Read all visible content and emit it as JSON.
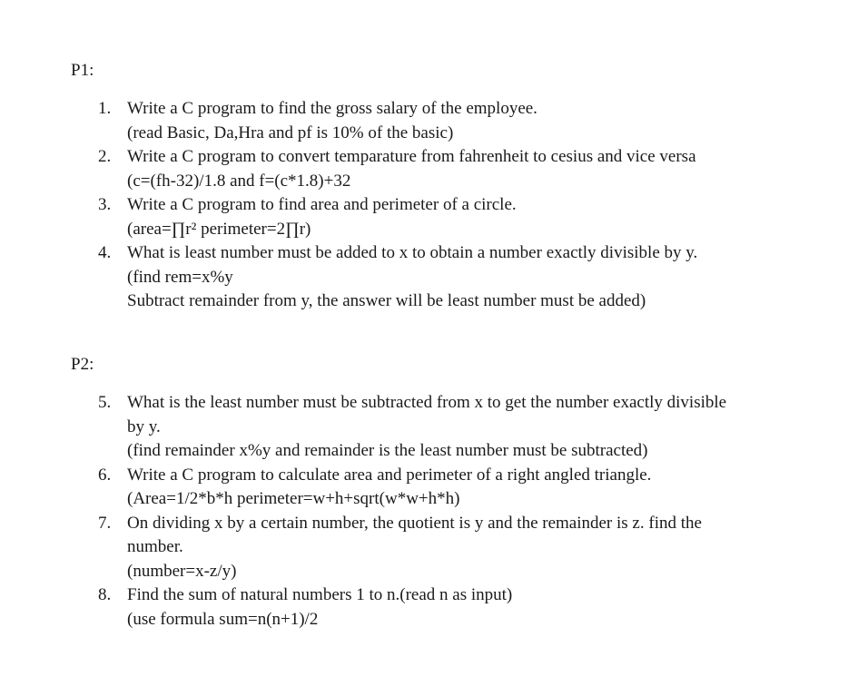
{
  "sections": [
    {
      "heading": "P1:",
      "problems": [
        {
          "number": "1.",
          "lines": [
            "Write a C program to find the gross salary of the employee.",
            "(read Basic, Da,Hra and pf is 10% of the basic)"
          ]
        },
        {
          "number": "2.",
          "lines": [
            "Write a C program to convert temparature from fahrenheit to cesius and vice versa",
            "(c=(fh-32)/1.8 and f=(c*1.8)+32"
          ]
        },
        {
          "number": "3.",
          "lines": [
            "Write a C program to find area and perimeter of a circle.",
            "(area=∏r² perimeter=2∏r)"
          ]
        },
        {
          "number": "4.",
          "lines": [
            "What is least number must be added to x to obtain a number exactly divisible by y.",
            "(find rem=x%y",
            "Subtract remainder from y, the answer will be least number must be added)"
          ]
        }
      ]
    },
    {
      "heading": "P2:",
      "problems": [
        {
          "number": "5.",
          "lines": [
            "What  is the least number must be subtracted from x to get the number exactly divisible",
            "by y.",
            "(find remainder x%y and remainder is the least number must be subtracted)"
          ]
        },
        {
          "number": "6.",
          "lines": [
            "Write  a C program to calculate area and perimeter of a right angled triangle.",
            "(Area=1/2*b*h perimeter=w+h+sqrt(w*w+h*h)"
          ]
        },
        {
          "number": "7.",
          "lines": [
            "On dividing x by a certain number, the quotient is y and the remainder is z. find the",
            "number.",
            "(number=x-z/y)"
          ]
        },
        {
          "number": "8.",
          "lines": [
            "Find the sum of natural numbers 1 to n.(read n as input)",
            "(use formula sum=n(n+1)/2"
          ]
        }
      ]
    }
  ]
}
